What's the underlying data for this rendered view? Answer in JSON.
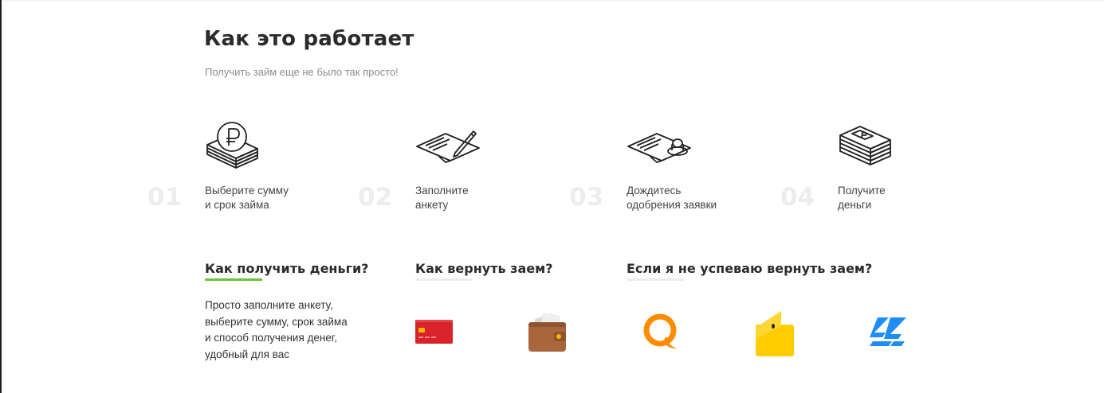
{
  "header": {
    "title": "Как это работает",
    "subtitle": "Получить займ еще не было так просто!"
  },
  "steps": [
    {
      "number": "01",
      "icon": "ruble-money-icon",
      "line1": "Выберите сумму",
      "line2": "и срок займа"
    },
    {
      "number": "02",
      "icon": "form-pen-icon",
      "line1": "Заполните",
      "line2": "анкету"
    },
    {
      "number": "03",
      "icon": "form-stamp-icon",
      "line1": "Дождитесь",
      "line2": "одобрения заявки"
    },
    {
      "number": "04",
      "icon": "cash-stack-icon",
      "line1": "Получите",
      "line2": "деньги"
    }
  ],
  "questions": [
    {
      "title": "Как получить деньги?",
      "active": true
    },
    {
      "title": "Как вернуть заем?",
      "active": false
    },
    {
      "title": "Если я не успеваю вернуть заем?",
      "active": false
    }
  ],
  "answer": {
    "lines": [
      "Просто заполните анкету,",
      "выберите сумму, срок займа",
      "и способ получения денег,",
      "удобный для вас"
    ]
  },
  "payment_methods": [
    "bank-card-icon",
    "wallet-icon",
    "qiwi-icon",
    "yandex-money-icon",
    "zolotaya-korona-icon"
  ],
  "colors": {
    "accent": "#6ac43a",
    "card": "#d8232a",
    "wallet": "#a8663a",
    "qiwi": "#ff8c00",
    "yandex": "#ffcc00",
    "korona": "#1e8ef5"
  }
}
